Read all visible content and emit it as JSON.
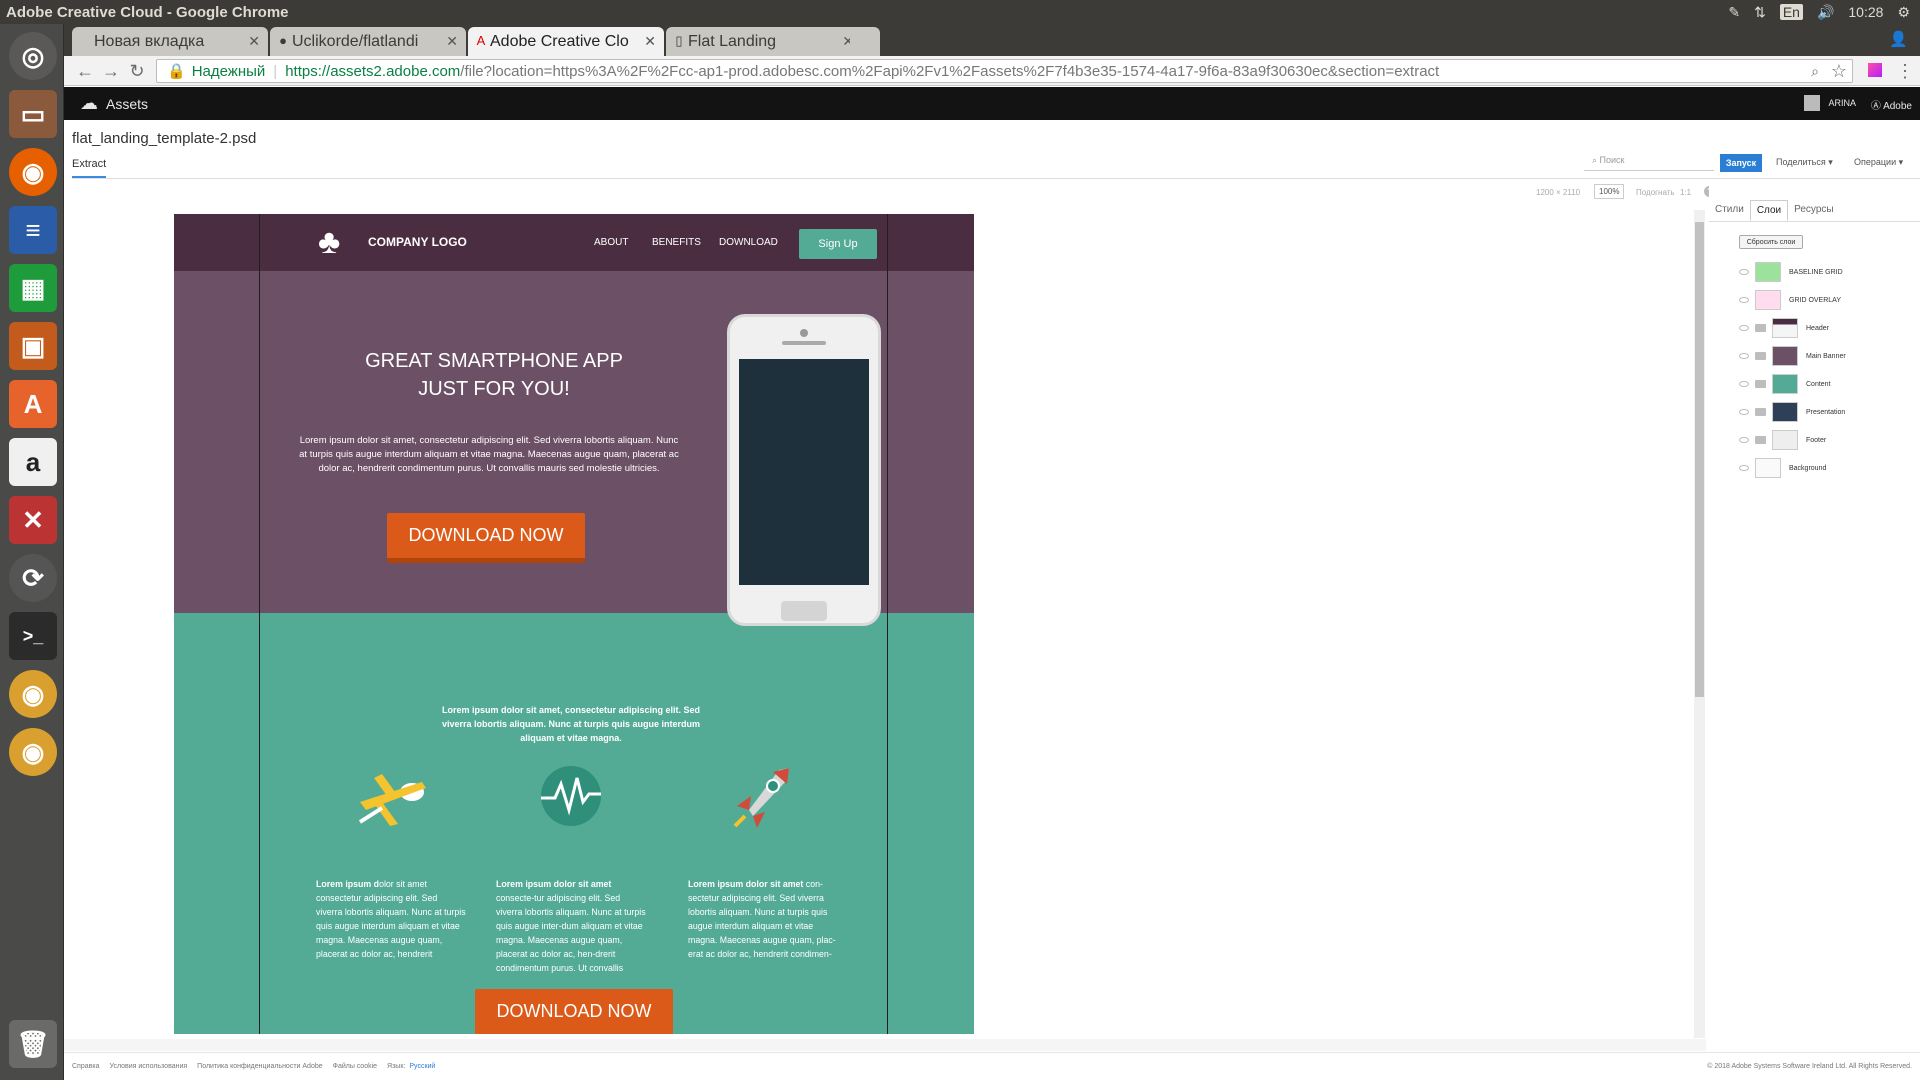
{
  "window_title": "Adobe Creative Cloud - Google Chrome",
  "system": {
    "lang": "En",
    "time": "10:28"
  },
  "tabs": [
    {
      "label": "Новая вкладка"
    },
    {
      "label": "Uclikorde/flatlandi"
    },
    {
      "label": "Adobe Creative Clo"
    },
    {
      "label": "Flat Landing"
    }
  ],
  "address": {
    "secure_label": "Надежный",
    "host": "https://assets2.adobe.com",
    "path": "/file?location=https%3A%2F%2Fcc-ap1-prod.adobesc.com%2Fapi%2Fv1%2Fassets%2F7f4b3e35-1574-4a17-9f6a-83a9f30630ec&section=extract"
  },
  "adobe_bar": {
    "title": "Assets",
    "user": "ARINA",
    "brand": "Adobe"
  },
  "file": {
    "name": "flat_landing_template-2.psd",
    "tab": "Extract"
  },
  "actions": {
    "search_placeholder": "Поиск",
    "run": "Запуск",
    "share": "Поделиться",
    "ops": "Операции"
  },
  "zoom": {
    "dims": "1200 × 2110",
    "level": "100%",
    "fit": "Подогнать",
    "ratio": "1:1"
  },
  "panel": {
    "tabs": [
      "Стили",
      "Слои",
      "Ресурсы"
    ],
    "active_tab": "Слои",
    "reset": "Сбросить слои",
    "layers": [
      "BASELINE GRID",
      "GRID OVERLAY",
      "Header",
      "Main Banner",
      "Content",
      "Presentation",
      "Footer",
      "Background"
    ]
  },
  "mock": {
    "logo": "COMPANY LOGO",
    "nav": [
      "ABOUT",
      "BENEFITS",
      "DOWNLOAD"
    ],
    "signup": "Sign Up",
    "headline_1": "GREAT SMARTPHONE APP",
    "headline_2": "JUST FOR YOU!",
    "intro": "Lorem ipsum dolor sit amet, consectetur adipiscing elit. Sed viverra lobortis aliquam. Nunc at turpis quis augue interdum aliquam et vitae magna. Maecenas augue quam, placerat ac dolor ac, hendrerit condimentum purus. Ut convallis mauris sed molestie ultricies.",
    "download": "DOWNLOAD NOW",
    "center_text": "Lorem ipsum dolor sit amet, consectetur adipiscing elit. Sed viverra lobortis aliquam. Nunc at turpis quis augue interdum aliquam et vitae magna.",
    "col1_bold": "Lorem ipsum d",
    "col1_text": "olor sit amet consectetur adipiscing elit. Sed viverra lobortis aliquam. Nunc at turpis quis augue interdum aliquam et vitae magna. Maecenas augue quam, placerat ac dolor ac, hendrerit",
    "col2_bold": "Lorem ipsum dolor sit amet",
    "col2_text": " consecte-tur adipiscing elit. Sed viverra lobortis aliquam. Nunc at turpis quis augue inter-dum aliquam et vitae magna. Maecenas augue quam, placerat ac dolor ac, hen-drerit condimentum purus. Ut convallis",
    "col3_bold": "Lorem ipsum dolor sit amet",
    "col3_text": " con-sectetur adipiscing elit. Sed viverra lobortis aliquam. Nunc at turpis quis augue interdum aliquam et vitae magna. Maecenas augue quam, plac-erat ac dolor ac, hendrerit condimen-"
  },
  "footer": {
    "links": [
      "Справка",
      "Условия использования",
      "Политика конфиденциальности Adobe",
      "Файлы cookie"
    ],
    "lang_label": "Язык:",
    "lang": "Русский",
    "copyright": "© 2018 Adobe Systems Software Ireland Ltd. All Rights Reserved."
  },
  "colors": {
    "header": "#4b2d42",
    "banner": "#6c5065",
    "content": "#53ab95",
    "cta": "#db5a19",
    "primary": "#2a7fd4"
  }
}
